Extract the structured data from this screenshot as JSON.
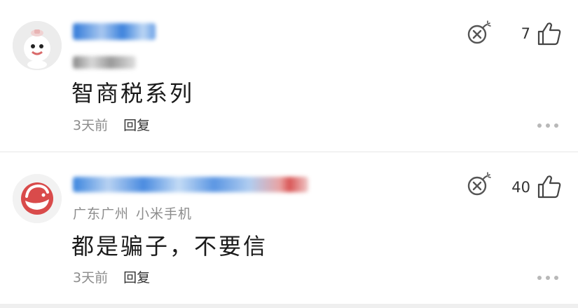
{
  "comments": [
    {
      "text": "智商税系列",
      "time": "3天前",
      "reply": "回复",
      "like_count": "7"
    },
    {
      "location": "广东广州",
      "device": "小米手机",
      "text": "都是骗子，不要信",
      "time": "3天前",
      "reply": "回复",
      "like_count": "40"
    }
  ],
  "icons": {
    "report": "bomb-icon",
    "like": "thumbs-up-icon",
    "more": "more-dots-icon"
  },
  "colors": {
    "muted_text": "#8c8c8c",
    "primary_text": "#1a1a1a",
    "avatar2_red": "#d94b4b"
  }
}
